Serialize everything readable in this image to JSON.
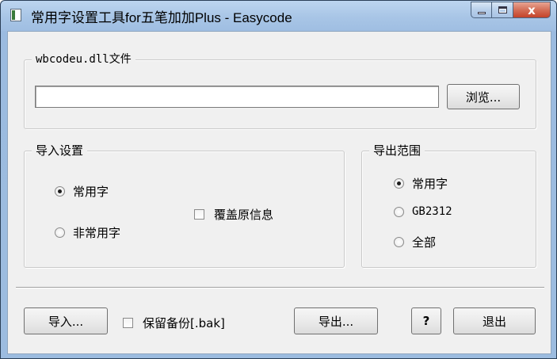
{
  "window": {
    "title": "常用字设置工具for五笔加加Plus   -   Easycode",
    "close_glyph": "x"
  },
  "file_group": {
    "legend": "wbcodeu.dll文件",
    "path_value": "",
    "browse_label": "浏览..."
  },
  "import_group": {
    "legend": "导入设置",
    "radio_common": "常用字",
    "radio_uncommon": "非常用字",
    "overwrite_label": "覆盖原信息"
  },
  "export_group": {
    "legend": "导出范围",
    "radio_common": "常用字",
    "radio_gb2312": "GB2312",
    "radio_all": "全部"
  },
  "footer": {
    "import_label": "导入...",
    "backup_label": "保留备份[.bak]",
    "export_label": "导出...",
    "help_label": "?",
    "exit_label": "退出"
  },
  "state": {
    "import_selected": "常用字",
    "export_selected": "常用字",
    "overwrite_checked": false,
    "backup_checked": false
  }
}
